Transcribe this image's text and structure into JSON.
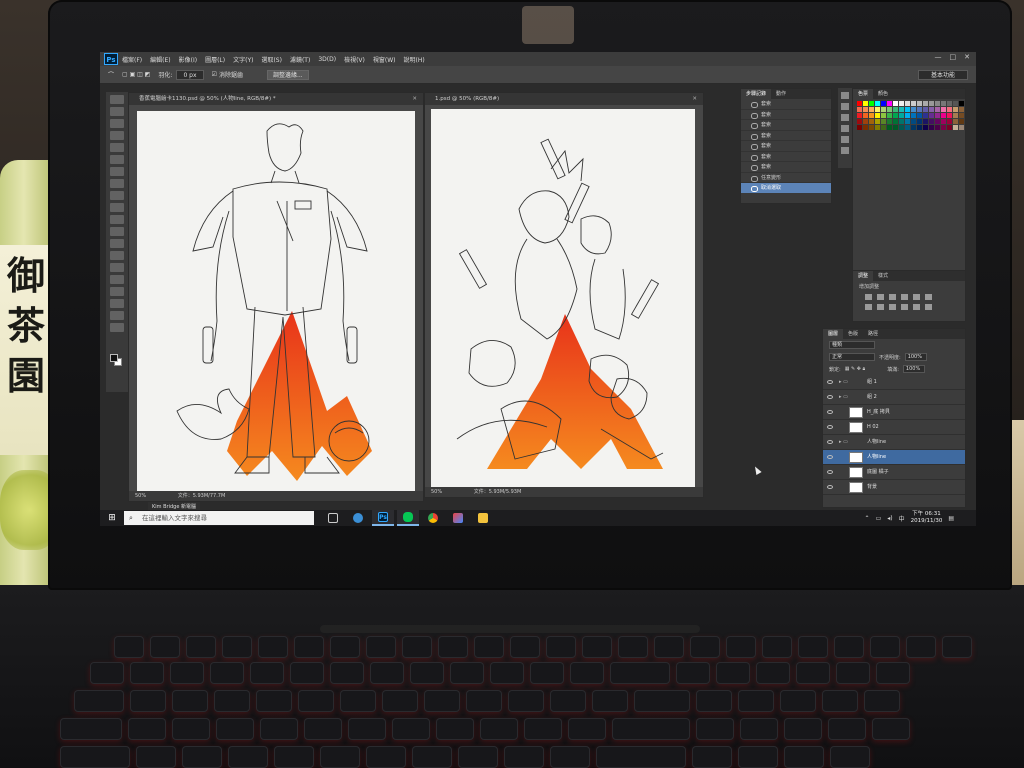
{
  "bottle_text": [
    "御",
    "茶",
    "園"
  ],
  "menubar": {
    "app_icon": "Ps",
    "items": [
      "檔案(F)",
      "編輯(E)",
      "影像(I)",
      "圖層(L)",
      "文字(Y)",
      "選取(S)",
      "濾鏡(T)",
      "3D(D)",
      "檢視(V)",
      "視窗(W)",
      "說明(H)"
    ]
  },
  "options_bar": {
    "feather_label": "羽化:",
    "feather_value": "0 px",
    "antialias_label": "消除鋸齒",
    "refine_button": "調整邊緣...",
    "workspace": "基本功能"
  },
  "documents": [
    {
      "tab_title": "香蕉電腦繪卡1130.psd @ 50% (人物line, RGB/8#) *",
      "zoom": "50%",
      "doc_info": "文件：5.93M/77.7M"
    },
    {
      "tab_title": "1.psd @ 50% (RGB/8#)",
      "zoom": "50%",
      "doc_info": "文件：5.93M/5.93M"
    }
  ],
  "history_panel": {
    "tabs": [
      "步驟記錄",
      "動作"
    ],
    "rows": [
      "套索",
      "套索",
      "套索",
      "套索",
      "套索",
      "套索",
      "套索",
      "任意變形",
      "取消選取"
    ],
    "selected_index": 8
  },
  "swatches_panel": {
    "tabs": [
      "色票",
      "顏色"
    ],
    "colors": [
      "#ff0000",
      "#ffff00",
      "#00ff00",
      "#00ffff",
      "#0000ff",
      "#ff00ff",
      "#ffffff",
      "#eeeeee",
      "#dddddd",
      "#cccccc",
      "#bbbbbb",
      "#aaaaaa",
      "#999999",
      "#888888",
      "#777777",
      "#666666",
      "#555555",
      "#000000",
      "#f26c4f",
      "#f68e55",
      "#fbaf5c",
      "#fff467",
      "#acd372",
      "#7cc576",
      "#3bb878",
      "#1abbb4",
      "#00bff3",
      "#438ccb",
      "#5574b9",
      "#605ca8",
      "#855fa8",
      "#a763a8",
      "#f06ea9",
      "#f26d7d",
      "#c69c6d",
      "#8c6239",
      "#ed1c24",
      "#f26522",
      "#f7941d",
      "#fff200",
      "#8dc63f",
      "#39b54a",
      "#00a651",
      "#00a99d",
      "#00aeef",
      "#0072bc",
      "#0054a6",
      "#2e3192",
      "#662d91",
      "#92278f",
      "#ec008c",
      "#ed145b",
      "#a67c52",
      "#754c24",
      "#9e0b0f",
      "#a0410d",
      "#a3620a",
      "#aba000",
      "#598527",
      "#197b30",
      "#007236",
      "#00746b",
      "#0076a3",
      "#004a80",
      "#003471",
      "#1b1464",
      "#440e62",
      "#630460",
      "#9e005d",
      "#9e0039",
      "#8c6239",
      "#603913",
      "#790000",
      "#7b2e00",
      "#7d4900",
      "#827b00",
      "#406618",
      "#005e20",
      "#005826",
      "#005952",
      "#005b7f",
      "#003663",
      "#002157",
      "#0d004c",
      "#32004b",
      "#4b0049",
      "#7b0046",
      "#7a0026",
      "#c7b299",
      "#998675"
    ]
  },
  "adjustments_panel": {
    "tabs": [
      "調整",
      "樣式"
    ],
    "label": "增加調整"
  },
  "layers_panel": {
    "tabs": [
      "圖層",
      "色版",
      "路徑"
    ],
    "filter_label": "種類",
    "blend_mode": "正常",
    "opacity_label": "不透明度:",
    "opacity_value": "100%",
    "lock_label": "鎖定:",
    "fill_label": "填滿:",
    "fill_value": "100%",
    "layers": [
      {
        "name": "組 1",
        "type": "group"
      },
      {
        "name": "組 2",
        "type": "group"
      },
      {
        "name": "H_底 拷貝",
        "type": "layer"
      },
      {
        "name": "H 02",
        "type": "layer"
      },
      {
        "name": "人物line",
        "type": "group"
      },
      {
        "name": "人物line",
        "type": "layer"
      },
      {
        "name": "底圖 橘子",
        "type": "layer"
      },
      {
        "name": "背景",
        "type": "layer"
      }
    ],
    "selected_index": 5
  },
  "taskbar": {
    "start_icon": "⊞",
    "search_placeholder": "在這裡輸入文字來搜尋",
    "tooltip": "Kim Bridge  新電腦",
    "apps": [
      "file-explorer",
      "photoshop",
      "line",
      "chrome",
      "paint",
      "folder"
    ],
    "active_app": "photoshop",
    "clock_period": "下午 06:31",
    "clock_date": "2019/11/30"
  },
  "artwork": {
    "gradient_top": "#e8331a",
    "gradient_bottom": "#f58a1f"
  }
}
